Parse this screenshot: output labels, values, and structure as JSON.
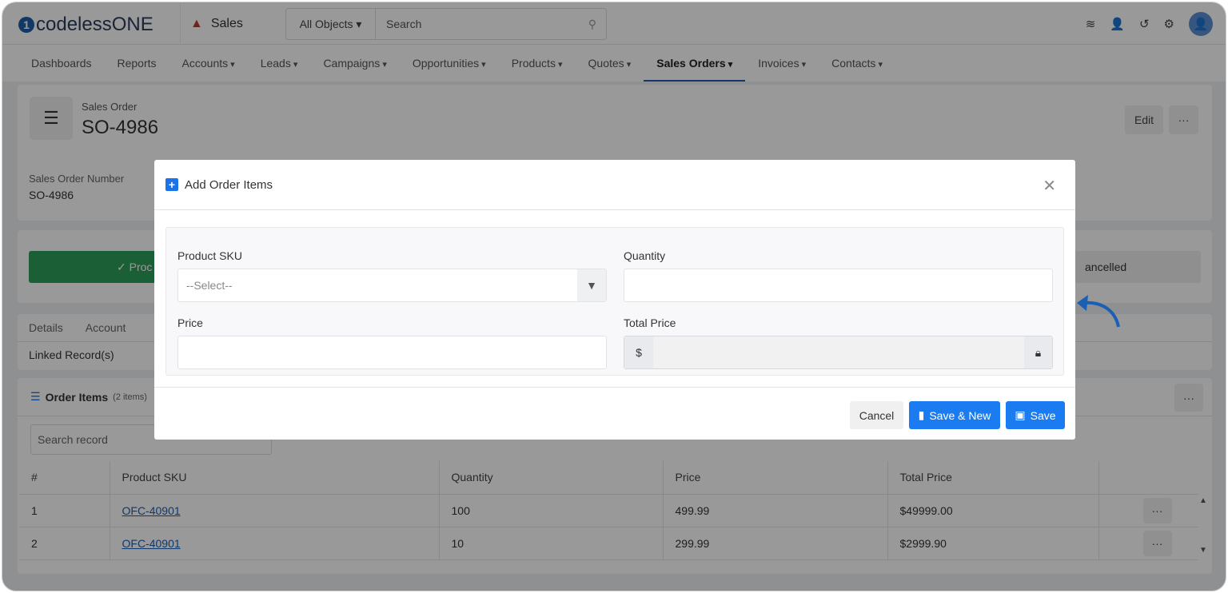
{
  "brand": {
    "logo": "codelessONE",
    "app": "Sales"
  },
  "search": {
    "scope": "All Objects",
    "placeholder": "Search"
  },
  "nav": [
    {
      "label": "Dashboards",
      "dd": false
    },
    {
      "label": "Reports",
      "dd": false
    },
    {
      "label": "Accounts",
      "dd": true
    },
    {
      "label": "Leads",
      "dd": true
    },
    {
      "label": "Campaigns",
      "dd": true
    },
    {
      "label": "Opportunities",
      "dd": true
    },
    {
      "label": "Products",
      "dd": true
    },
    {
      "label": "Quotes",
      "dd": true
    },
    {
      "label": "Sales Orders",
      "dd": true,
      "active": true
    },
    {
      "label": "Invoices",
      "dd": true
    },
    {
      "label": "Contacts",
      "dd": true
    }
  ],
  "record": {
    "type": "Sales Order",
    "title": "SO-4986",
    "edit": "Edit",
    "field_label": "Sales Order Number",
    "field_value": "SO-4986"
  },
  "status": {
    "first": "Processing",
    "last": "Cancelled",
    "first_visible": "✓ Proc",
    "last_visible": "ancelled"
  },
  "tabs": {
    "details": "Details",
    "account": "Account",
    "linked": "Linked Record(s)"
  },
  "order_items": {
    "title": "Order Items",
    "count": "(2 items)",
    "search_placeholder": "Search record",
    "columns": [
      "#",
      "Product SKU",
      "Quantity",
      "Price",
      "Total Price"
    ],
    "rows": [
      [
        "1",
        "OFC-40901",
        "100",
        "499.99",
        "$49999.00"
      ],
      [
        "2",
        "OFC-40901",
        "10",
        "299.99",
        "$2999.90"
      ]
    ]
  },
  "modal": {
    "title": "Add Order Items",
    "sku_label": "Product SKU",
    "sku_placeholder": "--Select--",
    "qty_label": "Quantity",
    "price_label": "Price",
    "total_label": "Total Price",
    "currency": "$",
    "cancel": "Cancel",
    "save_new": "Save & New",
    "save": "Save"
  },
  "colors": {
    "accent": "#1a7cf0",
    "brand": "#1e5fa8",
    "success": "#2e9e5b"
  }
}
